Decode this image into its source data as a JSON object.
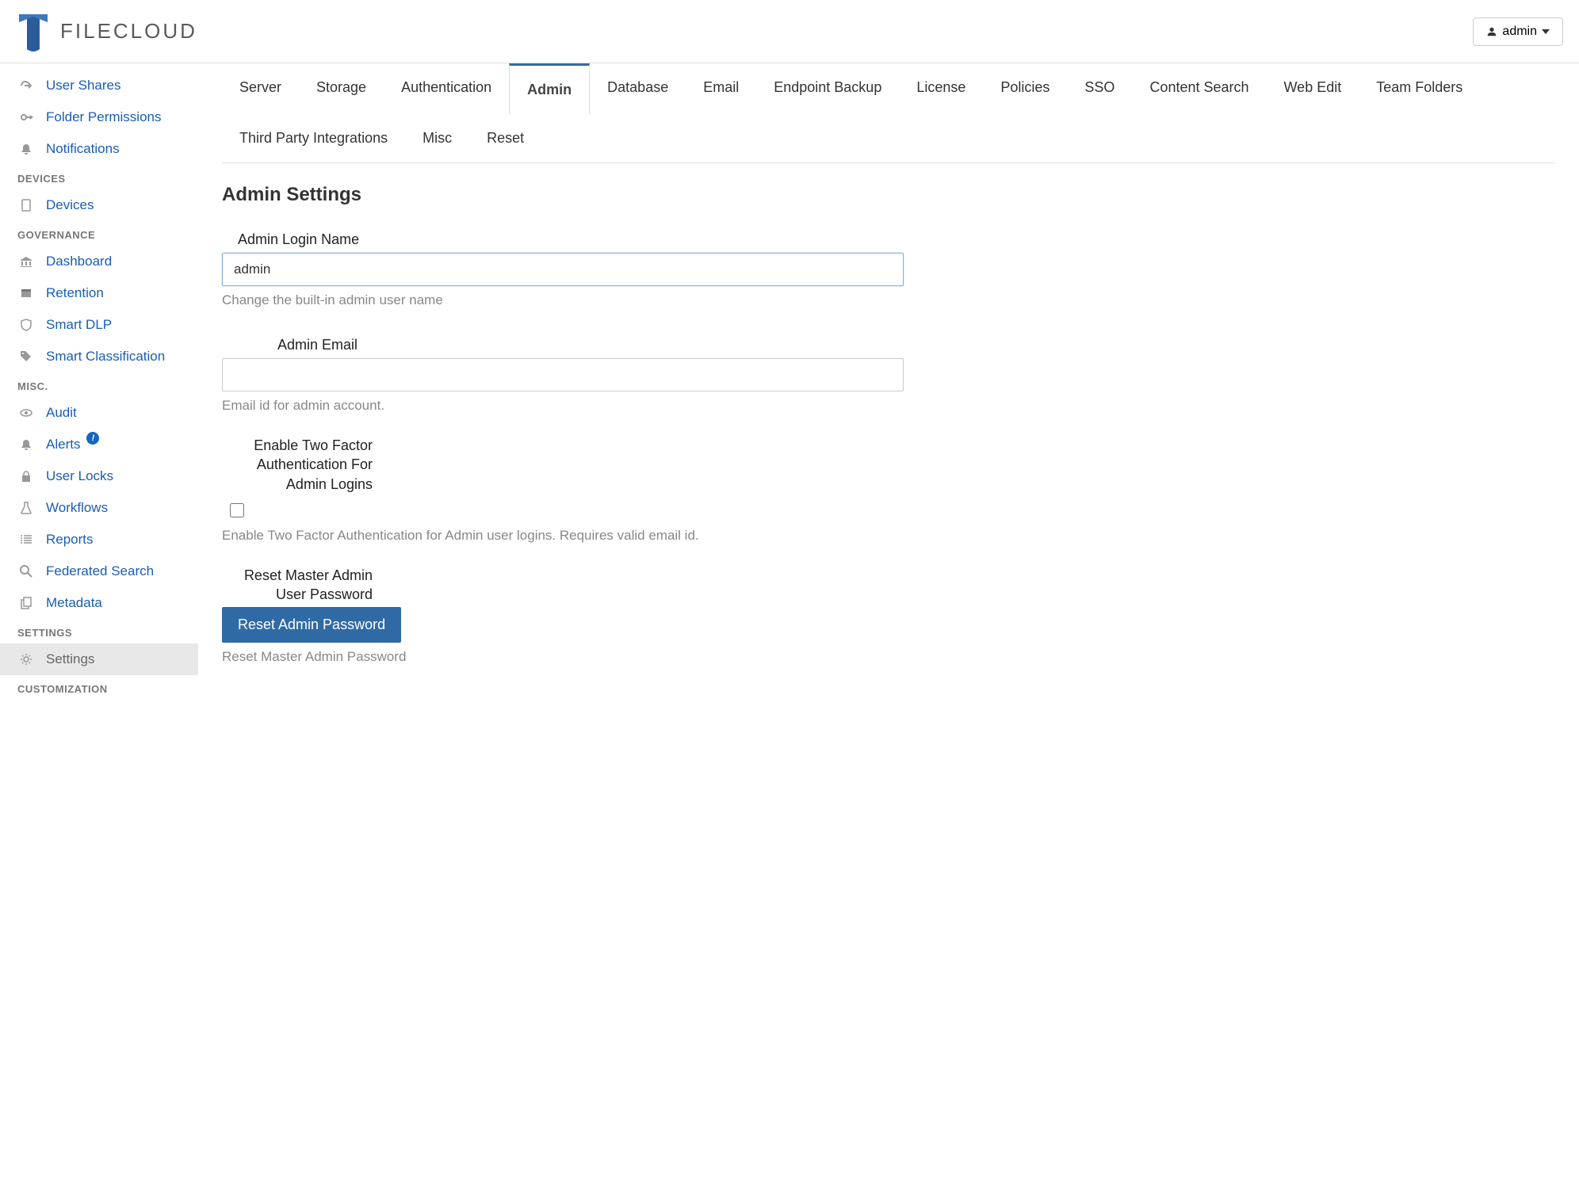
{
  "header": {
    "brand": "FILECLOUD",
    "user_label": "admin"
  },
  "sidebar": {
    "top": [
      {
        "id": "user-shares",
        "label": "User Shares",
        "icon": "share"
      },
      {
        "id": "folder-permissions",
        "label": "Folder Permissions",
        "icon": "key"
      },
      {
        "id": "notifications",
        "label": "Notifications",
        "icon": "bell"
      }
    ],
    "sections": [
      {
        "title": "DEVICES",
        "items": [
          {
            "id": "devices",
            "label": "Devices",
            "icon": "tablet"
          }
        ]
      },
      {
        "title": "GOVERNANCE",
        "items": [
          {
            "id": "dashboard",
            "label": "Dashboard",
            "icon": "bank"
          },
          {
            "id": "retention",
            "label": "Retention",
            "icon": "archive"
          },
          {
            "id": "smart-dlp",
            "label": "Smart DLP",
            "icon": "shield"
          },
          {
            "id": "smart-classification",
            "label": "Smart Classification",
            "icon": "tags"
          }
        ]
      },
      {
        "title": "MISC.",
        "items": [
          {
            "id": "audit",
            "label": "Audit",
            "icon": "eye"
          },
          {
            "id": "alerts",
            "label": "Alerts",
            "icon": "bell",
            "badge": "!"
          },
          {
            "id": "user-locks",
            "label": "User Locks",
            "icon": "lock"
          },
          {
            "id": "workflows",
            "label": "Workflows",
            "icon": "flask"
          },
          {
            "id": "reports",
            "label": "Reports",
            "icon": "list"
          },
          {
            "id": "federated-search",
            "label": "Federated Search",
            "icon": "search"
          },
          {
            "id": "metadata",
            "label": "Metadata",
            "icon": "files"
          }
        ]
      },
      {
        "title": "SETTINGS",
        "items": [
          {
            "id": "settings",
            "label": "Settings",
            "icon": "gear",
            "active": true
          }
        ]
      },
      {
        "title": "CUSTOMIZATION",
        "items": []
      }
    ]
  },
  "tabs": [
    "Server",
    "Storage",
    "Authentication",
    "Admin",
    "Database",
    "Email",
    "Endpoint Backup",
    "License",
    "Policies",
    "SSO",
    "Content Search",
    "Web Edit",
    "Team Folders",
    "Third Party Integrations",
    "Misc",
    "Reset"
  ],
  "active_tab": "Admin",
  "page": {
    "title": "Admin Settings",
    "login_name_label": "Admin Login Name",
    "login_name_value": "admin",
    "login_name_help": "Change the built-in admin user name",
    "email_label": "Admin Email",
    "email_value": "",
    "email_help": "Email id for admin account.",
    "tfa_label": "Enable Two Factor Authentication For Admin Logins",
    "tfa_help": "Enable Two Factor Authentication for Admin user logins. Requires valid email id.",
    "reset_label": "Reset Master Admin User Password",
    "reset_button": "Reset Admin Password",
    "reset_help": "Reset Master Admin Password"
  }
}
